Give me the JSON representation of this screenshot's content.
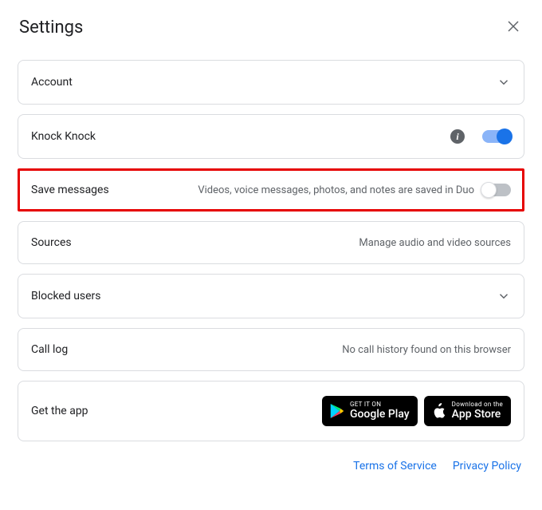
{
  "header": {
    "title": "Settings"
  },
  "rows": {
    "account": {
      "label": "Account"
    },
    "knock": {
      "label": "Knock Knock"
    },
    "save": {
      "label": "Save messages",
      "desc": "Videos, voice messages, photos, and notes are saved in Duo"
    },
    "sources": {
      "label": "Sources",
      "desc": "Manage audio and video sources"
    },
    "blocked": {
      "label": "Blocked users"
    },
    "calllog": {
      "label": "Call log",
      "desc": "No call history found on this browser"
    },
    "getapp": {
      "label": "Get the app"
    }
  },
  "store": {
    "google_top": "GET IT ON",
    "google_bottom": "Google Play",
    "apple_top": "Download on the",
    "apple_bottom": "App Store"
  },
  "footer": {
    "terms": "Terms of Service",
    "privacy": "Privacy Policy"
  }
}
